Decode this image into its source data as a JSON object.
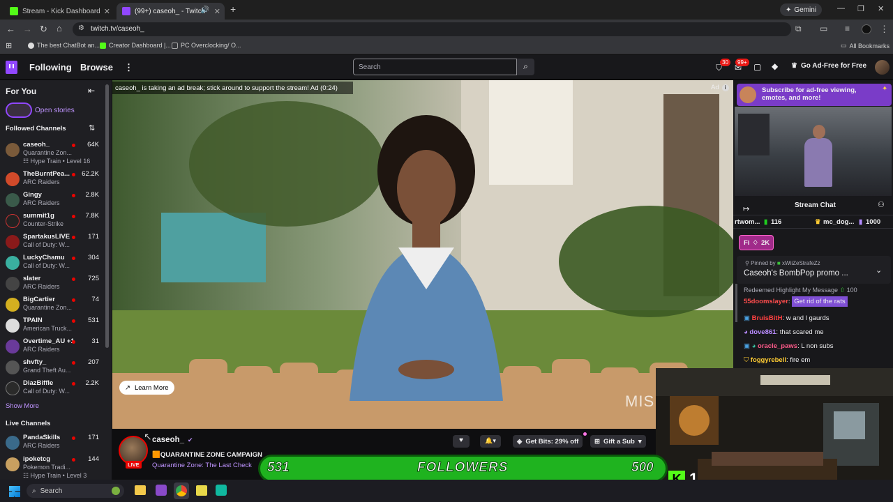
{
  "browser": {
    "tabs": [
      {
        "title": "Stream - Kick Dashboard",
        "active": false
      },
      {
        "title": "(99+) caseoh_ - Twitch",
        "active": true
      }
    ],
    "url": "twitch.tv/caseoh_",
    "gemini_label": "Gemini",
    "bookmarks": [
      "The best ChatBot an...",
      "Creator Dashboard |...",
      "PC Overclocking/ O..."
    ],
    "all_bookmarks": "All Bookmarks"
  },
  "topnav": {
    "following": "Following",
    "browse": "Browse",
    "search_placeholder": "Search",
    "notif_badge_1": "30",
    "notif_badge_2": "99+",
    "ad_free": "Go Ad-Free for Free"
  },
  "sidebar": {
    "for_you": "For You",
    "open_stories": "Open stories",
    "followed_channels": "Followed Channels",
    "channels": [
      {
        "name": "caseoh_",
        "game": "Quarantine Zon...",
        "viewers": "64K",
        "extra": "Hype Train • Level 16",
        "color": "#7a5a3a"
      },
      {
        "name": "TheBurntPea...",
        "game": "ARC Raiders",
        "viewers": "62.2K",
        "color": "#d14a2a"
      },
      {
        "name": "Gingy",
        "game": "ARC Raiders",
        "viewers": "2.8K",
        "color": "#3a5a4a"
      },
      {
        "name": "summit1g",
        "game": "Counter-Strike",
        "viewers": "7.8K",
        "color": "#222222"
      },
      {
        "name": "SpartakusLIVE",
        "game": "Call of Duty: W...",
        "viewers": "171",
        "color": "#8a1a1a"
      },
      {
        "name": "LuckyChamu",
        "game": "Call of Duty: W...",
        "viewers": "304",
        "color": "#3ab0a0"
      },
      {
        "name": "slater",
        "game": "ARC Raiders",
        "viewers": "725",
        "color": "#444444"
      },
      {
        "name": "BigCartier",
        "game": "Quarantine Zon...",
        "viewers": "74",
        "color": "#d4b020"
      },
      {
        "name": "TPAIN",
        "game": "American Truck...",
        "viewers": "531",
        "color": "#dddddd"
      },
      {
        "name": "Overtime_AU +1",
        "game": "ARC Raiders",
        "viewers": "31",
        "color": "#6a3a9a"
      },
      {
        "name": "shvfty_",
        "game": "Grand Theft Au...",
        "viewers": "207",
        "color": "#555555"
      },
      {
        "name": "DiazBiffle",
        "game": "Call of Duty: W...",
        "viewers": "2.2K",
        "color": "#2a2a2a"
      }
    ],
    "show_more": "Show More",
    "live_channels": "Live Channels",
    "live": [
      {
        "name": "PandaSkills",
        "game": "ARC Raiders",
        "viewers": "171",
        "color": "#3a6a8a"
      },
      {
        "name": "ipoketcg",
        "game": "Pokemon Tradi...",
        "viewers": "144",
        "extra": "Hype Train • Level 3",
        "color": "#c8a060"
      }
    ]
  },
  "video": {
    "ad_notice": "caseoh_ is taking an ad break; stick around to support the stream! Ad (0:24)",
    "ad_tag": "Ad",
    "learn_more": "Learn More",
    "watermark": "MIS"
  },
  "info": {
    "channel": "caseoh_",
    "live_badge": "LIVE",
    "title": "QUARANTINE ZONE CAMPAIGN",
    "category": "Quarantine Zone: The Last Check",
    "get_bits": "Get Bits: 29% off",
    "gift_sub": "Gift a Sub"
  },
  "chat": {
    "subscribe_banner": "Subscribe for ad-free viewing, emotes, and more!",
    "header": "Stream Chat",
    "leaderboard": [
      {
        "name": "rtwom...",
        "value": "116"
      },
      {
        "name": "mc_dog...",
        "value": "1000"
      }
    ],
    "hype_pill": "Fi",
    "hype_value": "2K",
    "pinned_by_label": "Pinned by",
    "pinned_by_user": "xWiiZeStrafeZz",
    "pinned_message": "Caseoh's BombPop promo ...",
    "redeem_text": "Redeemed Highlight My Message",
    "redeem_cost": "100",
    "messages": [
      {
        "user": "55doomslayer",
        "text": "Get rid of the rats",
        "color": "#ff4d4d",
        "highlight": true
      },
      {
        "user": "BruisBitH",
        "text": "w and l gaurds",
        "color": "#ff4040"
      },
      {
        "user": "dove861",
        "text": "that scared me",
        "color": "#b98cff"
      },
      {
        "user": "oracle_paws",
        "text": "L non subs",
        "color": "#ff5a8a"
      },
      {
        "user": "foggyrebell",
        "text": "fire em",
        "color": "#ffcc33"
      }
    ]
  },
  "overlay": {
    "followers_current": "531",
    "followers_label": "FOLLOWERS",
    "followers_goal": "500",
    "kick_count": "1"
  },
  "taskbar": {
    "search": "Search"
  },
  "colors": {
    "twitch_purple": "#9147ff",
    "live_red": "#eb0400",
    "followers_green": "#1fb31f",
    "kick_green": "#53fc18"
  }
}
